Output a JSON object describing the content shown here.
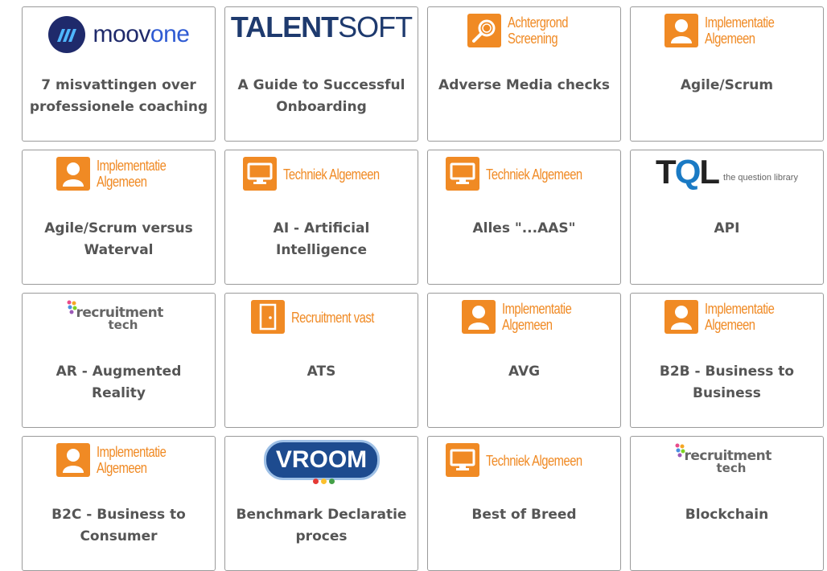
{
  "colors": {
    "orange": "#f08a24",
    "title_text": "#555555",
    "card_border": "#9a9a9a"
  },
  "cards": [
    {
      "title": "7 misvattingen over professionele coaching",
      "logo": {
        "type": "moovone",
        "text": "moovone"
      }
    },
    {
      "title": "A Guide to Successful Onboarding",
      "logo": {
        "type": "talentsoft",
        "text": "TALENTSOFT"
      }
    },
    {
      "title": "Adverse Media checks",
      "logo": {
        "type": "badge",
        "icon": "search-icon",
        "line1": "Achtergrond",
        "line2": "Screening"
      }
    },
    {
      "title": "Agile/Scrum",
      "logo": {
        "type": "badge",
        "icon": "person-icon",
        "line1": "Implementatie",
        "line2": "Algemeen"
      }
    },
    {
      "title": "Agile/Scrum versus Waterval",
      "logo": {
        "type": "badge",
        "icon": "person-icon",
        "line1": "Implementatie",
        "line2": "Algemeen"
      }
    },
    {
      "title": "AI - Artificial Intelligence",
      "logo": {
        "type": "badge",
        "icon": "monitor-icon",
        "line1": "Techniek Algemeen",
        "line2": ""
      }
    },
    {
      "title": "Alles \"...AAS\"",
      "logo": {
        "type": "badge",
        "icon": "monitor-icon",
        "line1": "Techniek Algemeen",
        "line2": ""
      }
    },
    {
      "title": "API",
      "logo": {
        "type": "tql",
        "text": "TQL",
        "tagline": "the question library"
      }
    },
    {
      "title": "AR - Augmented Reality",
      "logo": {
        "type": "recruitment-tech",
        "line1": "recruitment",
        "line2": "tech"
      }
    },
    {
      "title": "ATS",
      "logo": {
        "type": "badge",
        "icon": "door-icon",
        "line1": "Recruitment vast",
        "line2": ""
      }
    },
    {
      "title": "AVG",
      "logo": {
        "type": "badge",
        "icon": "person-icon",
        "line1": "Implementatie",
        "line2": "Algemeen"
      }
    },
    {
      "title": "B2B - Business to Business",
      "logo": {
        "type": "badge",
        "icon": "person-icon",
        "line1": "Implementatie",
        "line2": "Algemeen"
      }
    },
    {
      "title": "B2C - Business to Consumer",
      "logo": {
        "type": "badge",
        "icon": "person-icon",
        "line1": "Implementatie",
        "line2": "Algemeen"
      }
    },
    {
      "title": "Benchmark Declaratie proces",
      "logo": {
        "type": "vroom",
        "text": "VROOM"
      }
    },
    {
      "title": "Best of Breed",
      "logo": {
        "type": "badge",
        "icon": "monitor-icon",
        "line1": "Techniek Algemeen",
        "line2": ""
      }
    },
    {
      "title": "Blockchain",
      "logo": {
        "type": "recruitment-tech",
        "line1": "recruitment",
        "line2": "tech"
      }
    }
  ]
}
